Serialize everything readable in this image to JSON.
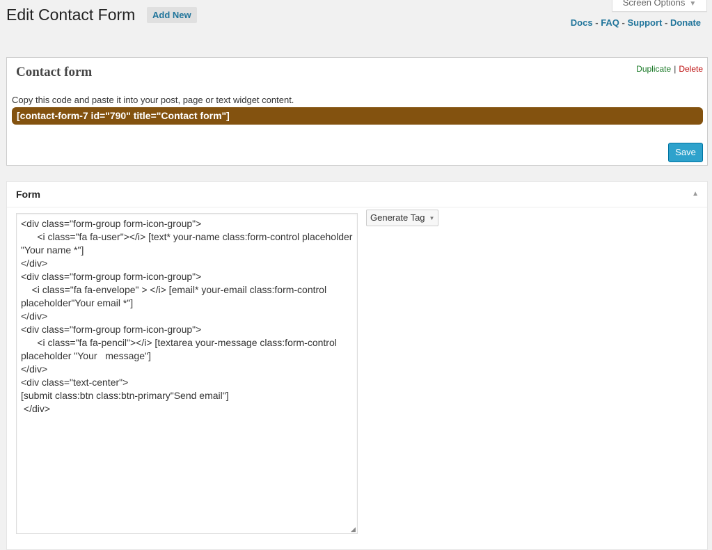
{
  "header": {
    "title": "Edit Contact Form",
    "add_new": "Add New",
    "screen_options": "Screen Options",
    "links": [
      "Docs",
      "FAQ",
      "Support",
      "Donate"
    ],
    "link_separator": "-"
  },
  "form_meta": {
    "name": "Contact form",
    "duplicate": "Duplicate",
    "action_separator": "|",
    "delete": "Delete",
    "copy_hint": "Copy this code and paste it into your post, page or text widget content.",
    "shortcode": "[contact-form-7 id=\"790\" title=\"Contact form\"]",
    "save_label": "Save"
  },
  "form_panel": {
    "title": "Form",
    "generate_tag": "Generate Tag",
    "code": "<div class=\"form-group form-icon-group\">\n      <i class=\"fa fa-user\"></i> [text* your-name class:form-control placeholder \"Your name *\"]\n</div>\n<div class=\"form-group form-icon-group\">\n    <i class=\"fa fa-envelope\" > </i> [email* your-email class:form-control placeholder\"Your email *\"]\n</div>\n<div class=\"form-group form-icon-group\">\n      <i class=\"fa fa-pencil\"></i> [textarea your-message class:form-control placeholder \"Your   message\"]\n</div>\n<div class=\"text-center\">\n[submit class:btn class:btn-primary\"Send email\"]\n </div>"
  },
  "colors": {
    "link_blue": "#21759b",
    "shortcode_bg": "#83520f",
    "save_blue": "#2ea2cc",
    "duplicate_green": "#1b7a28",
    "delete_red": "#bc0b0b"
  }
}
